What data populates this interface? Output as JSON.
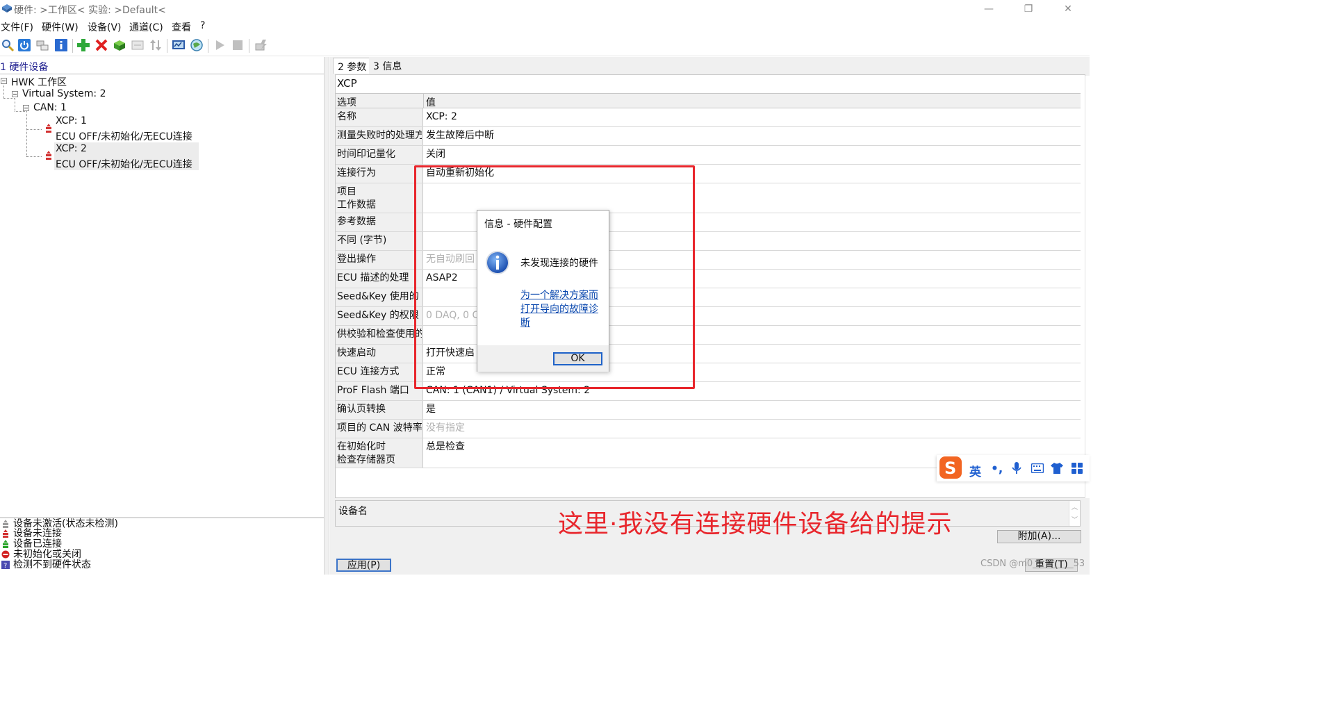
{
  "window": {
    "title": "硬件: >工作区<  实验: >Default<",
    "minimize": "—",
    "restore": "❐",
    "close": "✕"
  },
  "menu": [
    "文件(F)",
    "硬件(W)",
    "设备(V)",
    "通道(C)",
    "查看",
    "?"
  ],
  "toolbar_icons": [
    "search-icon",
    "power-icon",
    "network-icon",
    "info-icon",
    "add-icon",
    "delete-icon",
    "module-icon",
    "disabled-icon",
    "sort-icon",
    "monitor-icon",
    "globe-icon",
    "play-icon",
    "stop-icon",
    "flash-icon"
  ],
  "left": {
    "header": "1 硬件设备",
    "tree": {
      "root": "HWK 工作区",
      "system": "Virtual System: 2",
      "can": "CAN: 1",
      "devices": [
        {
          "name": "XCP: 1",
          "status": "ECU OFF/未初始化/无ECU连接"
        },
        {
          "name": "XCP: 2",
          "status": "ECU OFF/未初始化/无ECU连接"
        }
      ]
    },
    "legend": [
      {
        "text": "设备未激活(状态未检测)",
        "color": "#9a9a9a"
      },
      {
        "text": "设备未连接",
        "color": "#d23030"
      },
      {
        "text": "设备已连接",
        "color": "#2aa52a"
      },
      {
        "text": "未初始化或关闭",
        "color": "#d22020"
      },
      {
        "text": "检测不到硬件状态",
        "color": "#4a4ab0"
      }
    ]
  },
  "right": {
    "tabs": [
      "2 参数",
      "3 信息"
    ],
    "device_title": "XCP",
    "grid_header": {
      "key": "选项",
      "value": "值"
    },
    "rows": [
      {
        "key": "名称",
        "value": "XCP: 2"
      },
      {
        "key": "测量失败时的处理方式",
        "value": "发生故障后中断"
      },
      {
        "key": "时间印记量化",
        "value": "关闭"
      },
      {
        "key": "连接行为",
        "value": "自动重新初始化"
      },
      {
        "key": "项目\n工作数据",
        "value": ""
      },
      {
        "key": "参考数据",
        "value": ""
      },
      {
        "key": "不同 (字节)",
        "value": ""
      },
      {
        "key": "登出操作",
        "value": "无自动刷回"
      },
      {
        "key": "ECU 描述的处理",
        "value": "ASAP2"
      },
      {
        "key": "Seed&Key 使用的",
        "value": ""
      },
      {
        "key": "Seed&Key 的权限",
        "value": "0 DAQ, 0 C"
      },
      {
        "key": "供校验和检查使用的",
        "value": ""
      },
      {
        "key": "快速启动",
        "value": "打开快速启"
      },
      {
        "key": "ECU 连接方式",
        "value": "正常"
      },
      {
        "key": "ProF Flash 端口",
        "value": "CAN: 1 (CAN1) / Virtual System: 2"
      },
      {
        "key": "确认页转换",
        "value": "是"
      },
      {
        "key": "项目的 CAN 波特率",
        "value": "没有指定"
      },
      {
        "key": "在初始化时\n检查存储器页",
        "value": "总是检查"
      }
    ],
    "device_name_label": "设备名",
    "buttons": {
      "add": "附加(A)...",
      "apply": "应用(P)",
      "reset": "重置(T)"
    }
  },
  "dialog": {
    "title": "信息 - 硬件配置",
    "message": "未发现连接的硬件",
    "link": "为一个解决方案而打开导向的故障诊断",
    "ok": "OK"
  },
  "annotation": "这里·我没有连接硬件设备给的提示",
  "ime": {
    "lang": "英",
    "punct": "•,"
  },
  "watermark": "CSDN @m0_________53"
}
